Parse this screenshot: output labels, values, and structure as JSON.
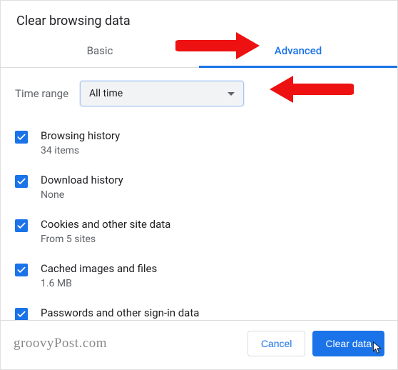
{
  "title": "Clear browsing data",
  "tabs": {
    "basic": "Basic",
    "advanced": "Advanced"
  },
  "time_range": {
    "label": "Time range",
    "value": "All time"
  },
  "items": [
    {
      "label": "Browsing history",
      "sub": "34 items"
    },
    {
      "label": "Download history",
      "sub": "None"
    },
    {
      "label": "Cookies and other site data",
      "sub": "From 5 sites"
    },
    {
      "label": "Cached images and files",
      "sub": "1.6 MB"
    },
    {
      "label": "Passwords and other sign-in data",
      "sub": ""
    }
  ],
  "buttons": {
    "cancel": "Cancel",
    "clear": "Clear data"
  },
  "watermark": "groovyPost.com"
}
